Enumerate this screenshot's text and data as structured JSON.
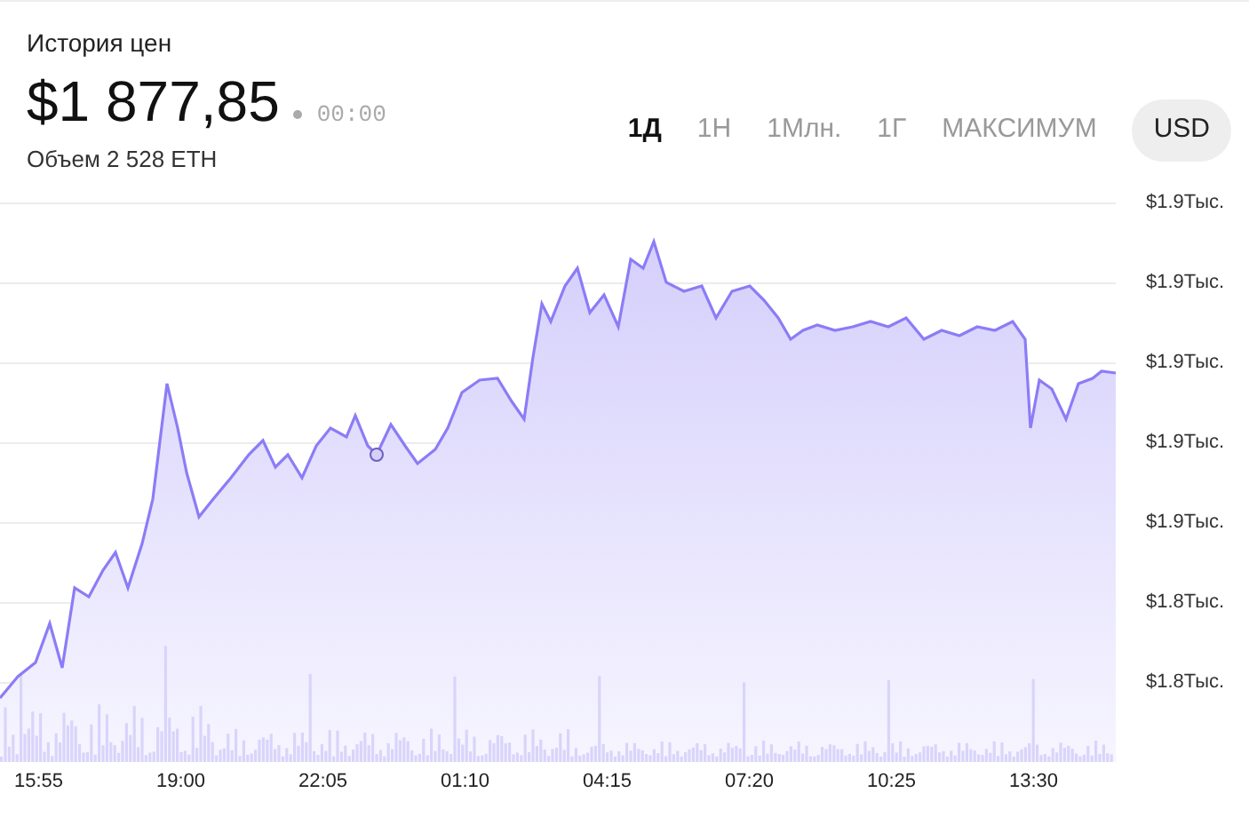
{
  "title": "История цен",
  "price": {
    "value": "$1 877,85",
    "time": "00:00",
    "volume": "Объем 2 528 ETH"
  },
  "ranges": [
    {
      "label": "1Д",
      "selected": true
    },
    {
      "label": "1Н",
      "selected": false
    },
    {
      "label": "1Млн.",
      "selected": false
    },
    {
      "label": "1Г",
      "selected": false
    },
    {
      "label": "МАКСИМУМ",
      "selected": false
    }
  ],
  "currency_button": "USD",
  "chart": {
    "y_labels": [
      "$1.9Тыс.",
      "$1.9Тыс.",
      "$1.9Тыс.",
      "$1.9Тыс.",
      "$1.9Тыс.",
      "$1.8Тыс.",
      "$1.8Тыс."
    ],
    "x_labels": [
      "15:55",
      "19:00",
      "22:05",
      "01:10",
      "04:15",
      "07:20",
      "10:25",
      "13:30"
    ]
  }
}
